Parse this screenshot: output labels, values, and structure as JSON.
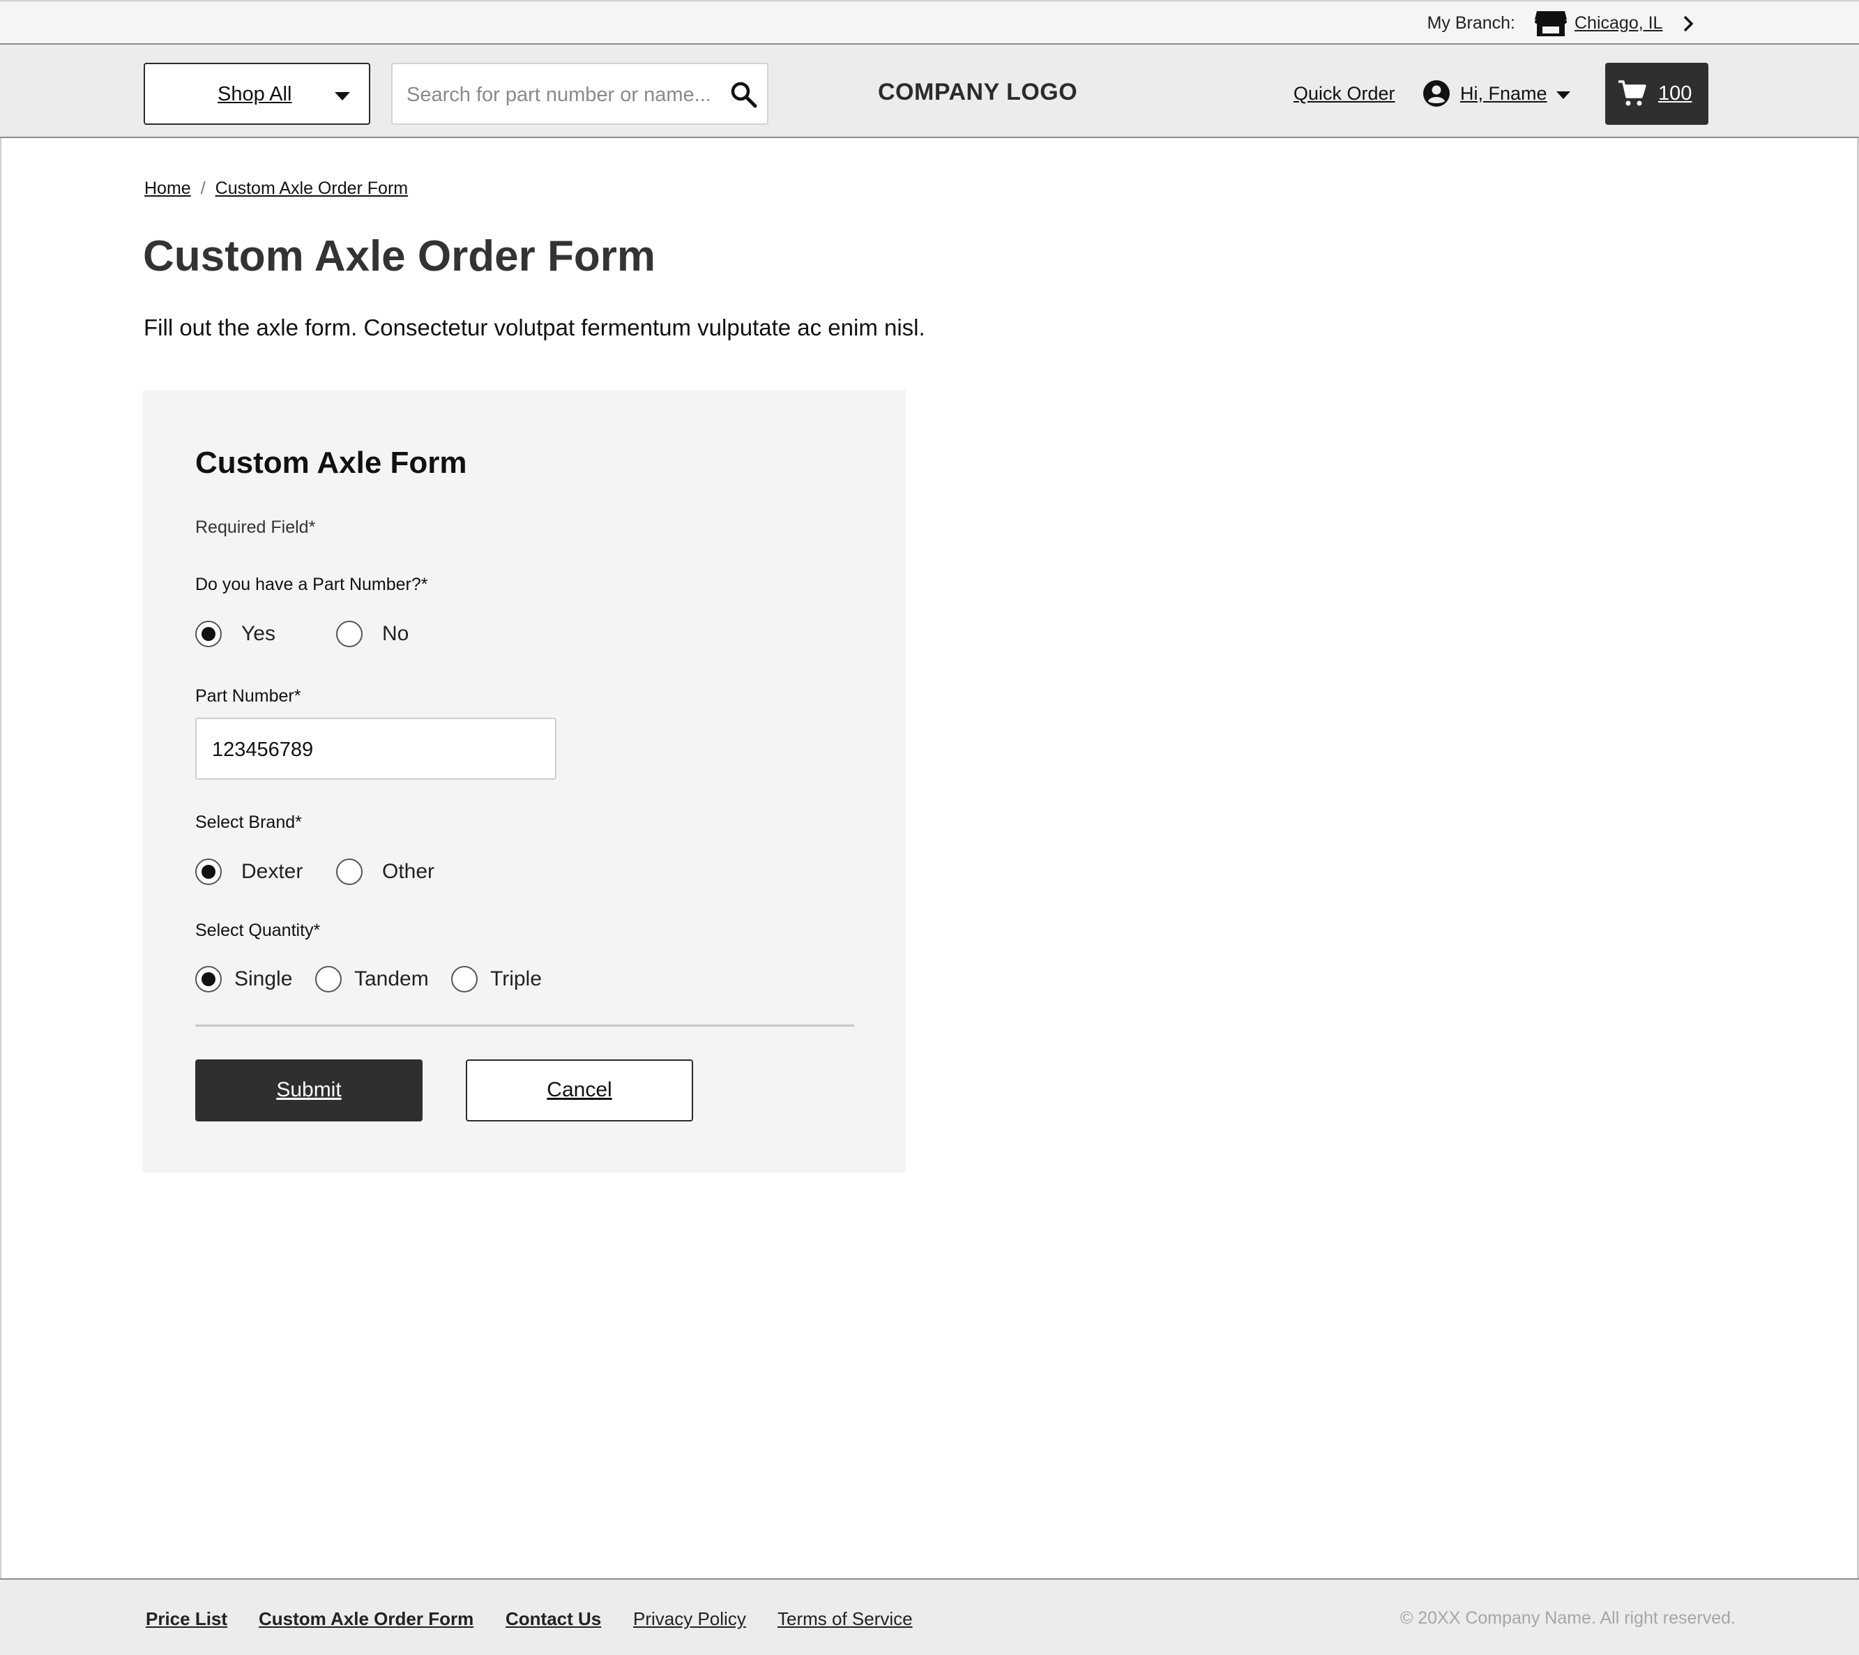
{
  "topbar": {
    "branch_label": "My Branch:",
    "branch_value": "Chicago, IL",
    "icons": [
      "store-icon",
      "chevron-right-icon"
    ]
  },
  "header": {
    "shop_all": "Shop All",
    "search_placeholder": "Search for part number or name...",
    "logo": "COMPANY LOGO",
    "quick_order": "Quick Order",
    "account": "Hi, Fname",
    "cart_count": "100",
    "icons": [
      "chevron-down-icon",
      "search-icon",
      "user-avatar-icon",
      "cart-icon"
    ]
  },
  "breadcrumb": {
    "home": "Home",
    "separator": "/",
    "current": "Custom Axle Order Form"
  },
  "page": {
    "title": "Custom Axle Order Form",
    "intro": "Fill out the axle form. Consectetur volutpat fermentum vulputate ac enim nisl."
  },
  "form": {
    "title": "Custom Axle Form",
    "required_note": "Required Field*",
    "part_question": {
      "label": "Do you have a Part Number?*",
      "options": [
        "Yes",
        "No"
      ],
      "selected": "Yes"
    },
    "part_number": {
      "label": "Part Number*",
      "value": "123456789"
    },
    "brand": {
      "label": "Select Brand*",
      "options": [
        "Dexter",
        "Other"
      ],
      "selected": "Dexter"
    },
    "quantity": {
      "label": "Select Quantity*",
      "options": [
        "Single",
        "Tandem",
        "Triple"
      ],
      "selected": "Single"
    },
    "submit": "Submit",
    "cancel": "Cancel"
  },
  "footer": {
    "links": [
      {
        "label": "Price List"
      },
      {
        "label": "Custom Axle Order Form"
      },
      {
        "label": "Contact Us"
      },
      {
        "label": "Privacy Policy"
      },
      {
        "label": "Terms of Service"
      }
    ],
    "copyright": "© 20XX Company Name. All right reserved."
  },
  "colors": {
    "dark_button": "#2f2f2f",
    "header_bg": "#ececec",
    "card_bg": "#f4f4f4"
  }
}
